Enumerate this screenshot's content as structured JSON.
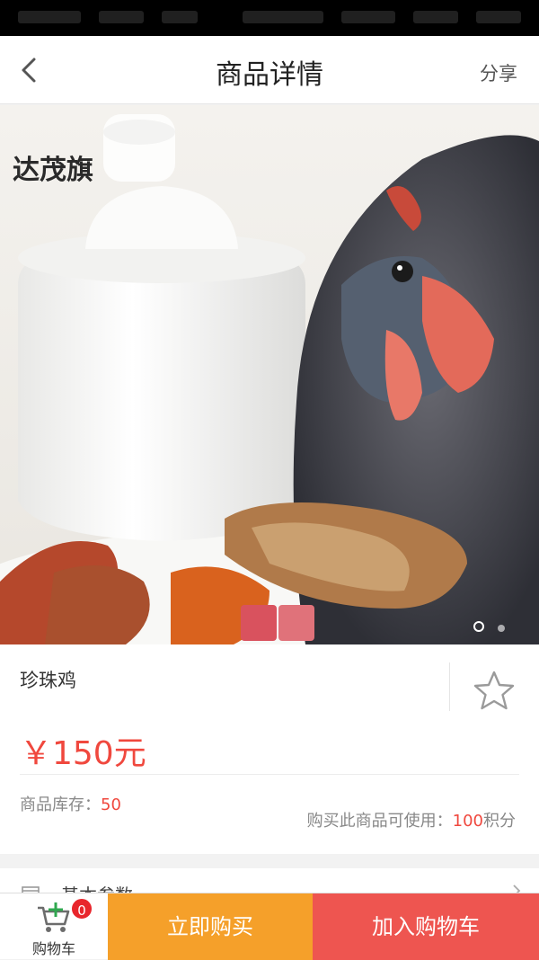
{
  "header": {
    "title": "商品详情",
    "share_label": "分享",
    "back_icon": "chevron-left-icon"
  },
  "hero": {
    "watermark": "达茂旗",
    "slides_total": 2,
    "slide_active": 1
  },
  "product": {
    "name": "珍珠鸡",
    "price": "￥150元",
    "stock_label": "商品库存：",
    "stock_value": "50",
    "points_prefix": "购买此商品可使用：",
    "points_value": "100",
    "points_suffix": "积分",
    "favorite_icon": "star-outline-icon"
  },
  "spec": {
    "label": "基本参数"
  },
  "bottom": {
    "cart_label": "购物车",
    "cart_count": "0",
    "buy_now_label": "立即购买",
    "add_to_cart_label": "加入购物车"
  },
  "colors": {
    "price": "#f0483e",
    "buy_now": "#f5a02a",
    "add_to_cart": "#ee5550",
    "badge": "#e8262c",
    "cart_icon": "#2fa84f"
  }
}
